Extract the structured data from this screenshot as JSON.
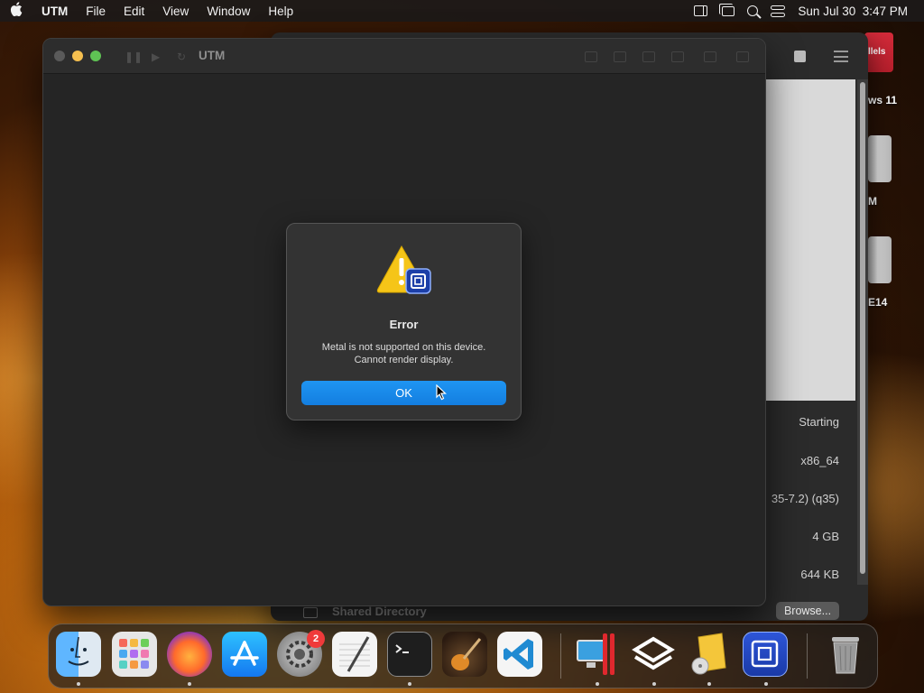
{
  "menubar": {
    "app_name": "UTM",
    "menus": [
      "File",
      "Edit",
      "View",
      "Window",
      "Help"
    ],
    "clock": "Sun Jul 30  3:47 PM",
    "status_icons": [
      "sidebar-icon",
      "screen-mirroring-icon",
      "search-icon",
      "control-center-icon"
    ]
  },
  "main_window": {
    "title": "UTM"
  },
  "dialog": {
    "title": "Error",
    "message_line1": "Metal is not supported on this device.",
    "message_line2": "Cannot render display.",
    "ok_label": "OK"
  },
  "background_window": {
    "info": {
      "status": "Starting",
      "architecture": "x86_64",
      "machine": "35-7.2) (q35)",
      "memory": "4 GB",
      "size": "644 KB"
    },
    "shared_directory_label": "Shared Directory",
    "browse_label": "Browse..."
  },
  "desktop": {
    "parallels_label": "llels",
    "icon_labels": [
      "ws 11",
      "M",
      "E14"
    ]
  },
  "dock": {
    "apps": [
      "Finder",
      "Launchpad",
      "Firefox",
      "App Store",
      "System Preferences",
      "TextEdit",
      "Terminal",
      "GarageBand",
      "Visual Studio Code",
      "Parallels Desktop",
      "VirtualBuddy",
      "Disk Utility",
      "UTM",
      "Trash"
    ],
    "system_preferences_badge": "2"
  },
  "colors": {
    "ok_button": "#1a8cf0",
    "dialog_bg": "#333333",
    "window_bg": "#252525"
  }
}
